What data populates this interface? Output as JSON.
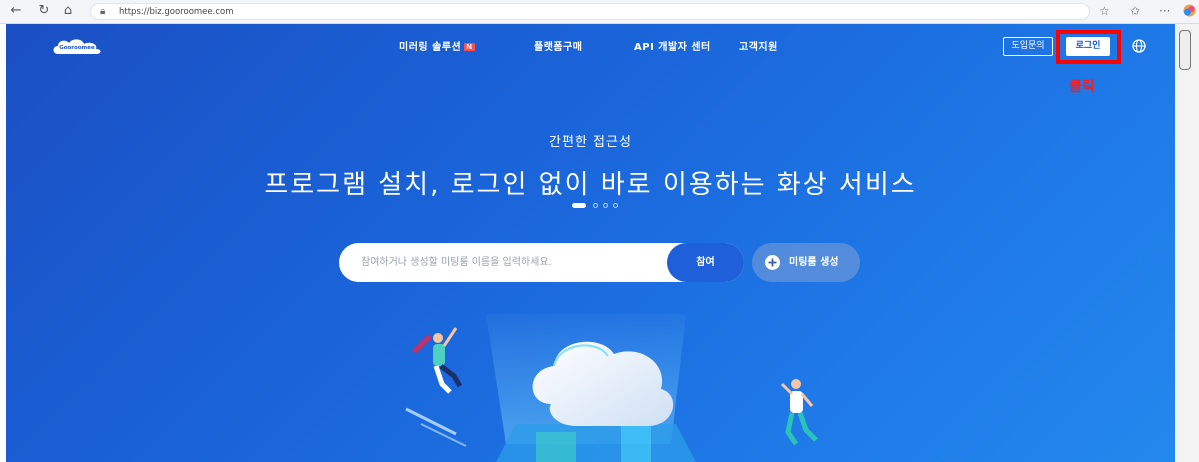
{
  "browser": {
    "url": "https://biz.gooroomee.com",
    "icons": [
      "back-arrow-icon",
      "refresh-icon",
      "home-icon",
      "lock-icon",
      "favorite-star-icon",
      "collections-icon",
      "more-icon",
      "copilot-icon"
    ]
  },
  "header": {
    "logo_text": "Gooroomee",
    "nav": [
      {
        "label": "미러링 솔루션",
        "badge": "N"
      },
      {
        "label": "플랫폼구매"
      },
      {
        "label": "API 개발자 센터"
      },
      {
        "label": "고객지원"
      }
    ],
    "inquiry_label": "도입문의",
    "login_label": "로그인"
  },
  "annotation": {
    "click_label": "클릭",
    "color": "#ff0000"
  },
  "hero": {
    "subtitle": "간편한 접근성",
    "title": "프로그램 설치, 로그인 없이 바로 이용하는 화상 서비스",
    "slide_count": 4,
    "active_slide": 1
  },
  "search": {
    "placeholder": "참여하거나 생성할 미팅룸 이름을 입력하세요.",
    "value": "",
    "join_label": "참여",
    "create_label": "미팅룸 생성"
  },
  "colors": {
    "bg_primary": "#1a64d9",
    "join_button": "#1f5fd9",
    "highlight": "#ff0000"
  }
}
